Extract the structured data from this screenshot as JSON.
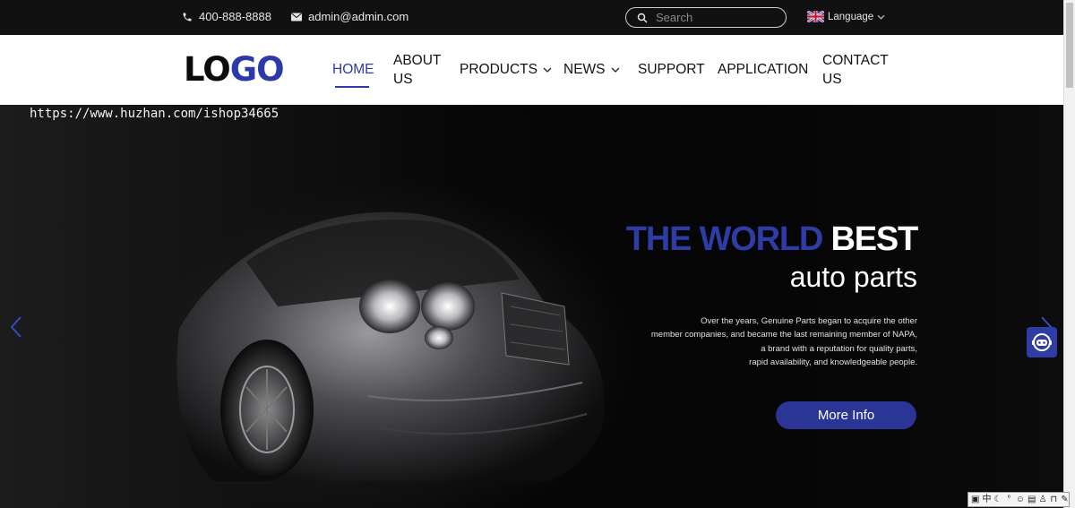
{
  "topbar": {
    "phone": "400-888-8888",
    "email": "admin@admin.com",
    "search_placeholder": "Search",
    "language": "Language",
    "phone_icon": "phone-icon",
    "email_icon": "envelope-icon",
    "search_icon": "search-icon",
    "flag_icon": "uk-flag-icon"
  },
  "nav": {
    "logo_dark": "LO",
    "logo_blue": "GO",
    "items": [
      {
        "label": "HOME",
        "active": true
      },
      {
        "label": "ABOUT",
        "label2": "US"
      },
      {
        "label": "PRODUCTS",
        "has_dropdown": true
      },
      {
        "label": "NEWS",
        "has_dropdown": true
      },
      {
        "label": "SUPPORT"
      },
      {
        "label": "APPLICATION"
      },
      {
        "label": "CONTACT",
        "label2": "US"
      }
    ]
  },
  "hero": {
    "watermark": "https://www.huzhan.com/ishop34665",
    "headline_blue": "THE WORLD",
    "headline_white": "BEST",
    "subhead": "auto parts",
    "desc_lines": [
      "Over the years, Genuine Parts began to acquire the other",
      "member companies, and  became the last remaining member of NAPA,",
      "a brand with a reputation for quality parts,",
      "rapid availability, and knowledgeable people."
    ],
    "button": "More Info"
  },
  "colors": {
    "accent": "#2d39a8",
    "topbar_bg": "#111111",
    "button_bg": "#2b3596"
  },
  "ime": [
    "中"
  ]
}
